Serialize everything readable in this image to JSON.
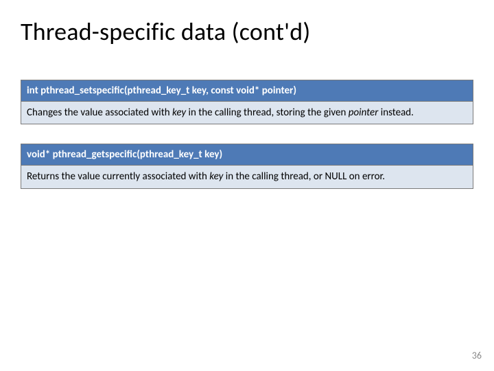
{
  "title": "Thread-specific data (cont'd)",
  "blocks": [
    {
      "signature": "int pthread_setspecific(pthread_key_t key, const void* pointer)",
      "desc_pre": "Changes the value associated with ",
      "desc_em1": "key",
      "desc_mid": " in the calling thread, storing the given ",
      "desc_em2": "pointer",
      "desc_post": " instead."
    },
    {
      "signature": "void* pthread_getspecific(pthread_key_t key)",
      "desc_pre": "Returns the value currently associated with ",
      "desc_em1": "key",
      "desc_mid": " in the calling thread, or NULL on error.",
      "desc_em2": "",
      "desc_post": ""
    }
  ],
  "page_number": "36"
}
